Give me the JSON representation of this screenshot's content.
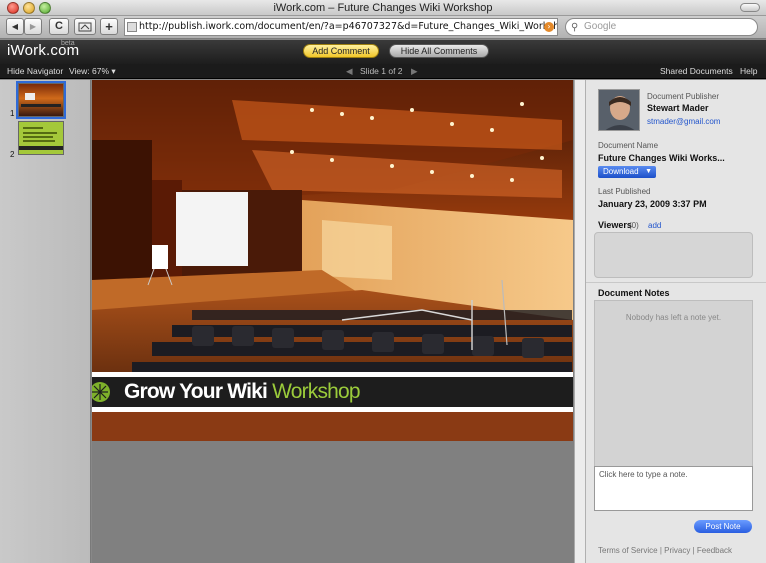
{
  "window": {
    "title": "iWork.com – Future Changes Wiki Workshop"
  },
  "browser": {
    "back_label": "◀",
    "forward_label": "▶",
    "reload_label": "C",
    "add_label": "+",
    "url": "http://publish.iwork.com/document/en/?a=p46707327&d=Future_Changes_Wiki_Workshop.key",
    "search_placeholder": "Google"
  },
  "header": {
    "logo": "iWork.com",
    "beta": "beta",
    "add_comment": "Add Comment",
    "hide_comments": "Hide All Comments"
  },
  "navbar": {
    "hide_navigator": "Hide Navigator",
    "view": "View: 67% ▾",
    "prev_icon": "◀",
    "slide_label": "Slide 1 of 2",
    "next_icon": "▶",
    "shared_documents": "Shared Documents",
    "help": "Help"
  },
  "navigator": {
    "slides": [
      {
        "number": "1"
      },
      {
        "number": "2"
      }
    ]
  },
  "slide": {
    "banner_main": "Grow Your Wiki ",
    "banner_accent": "Workshop"
  },
  "panel": {
    "publisher_label": "Document Publisher",
    "publisher_name": "Stewart Mader",
    "publisher_email": "stmader@gmail.com",
    "doc_name_label": "Document Name",
    "doc_name": "Future Changes Wiki Works...",
    "download": "Download",
    "last_published_label": "Last Published",
    "last_published": "January 23, 2009 3:37 PM",
    "viewers_label": "Viewers",
    "viewers_count": "(0)",
    "viewers_add": "add",
    "notes_label": "Document Notes",
    "notes_empty": "Nobody has left a note yet.",
    "note_placeholder": "Click here to type a note.",
    "post_note": "Post Note",
    "footer_terms": "Terms of Service",
    "footer_privacy": "Privacy",
    "footer_feedback": "Feedback",
    "footer_sep": "|"
  },
  "colors": {
    "accent_green": "#9bcb3b",
    "button_blue": "#2a5ee0",
    "comment_yellow": "#f1c629"
  }
}
